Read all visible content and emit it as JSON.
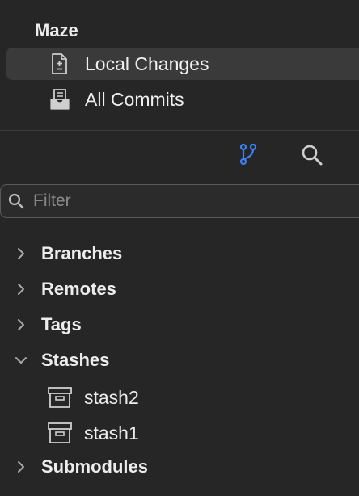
{
  "repo": {
    "name": "Maze"
  },
  "nav": {
    "local_changes": "Local Changes",
    "all_commits": "All Commits"
  },
  "toolbar": {
    "branch_icon": "branch-icon",
    "search_icon": "search-icon",
    "accent": "#3b82f6"
  },
  "filter": {
    "placeholder": "Filter",
    "value": ""
  },
  "sections": {
    "branches": "Branches",
    "remotes": "Remotes",
    "tags": "Tags",
    "stashes": "Stashes",
    "submodules": "Submodules"
  },
  "stashes": [
    {
      "name": "stash2"
    },
    {
      "name": "stash1"
    }
  ]
}
